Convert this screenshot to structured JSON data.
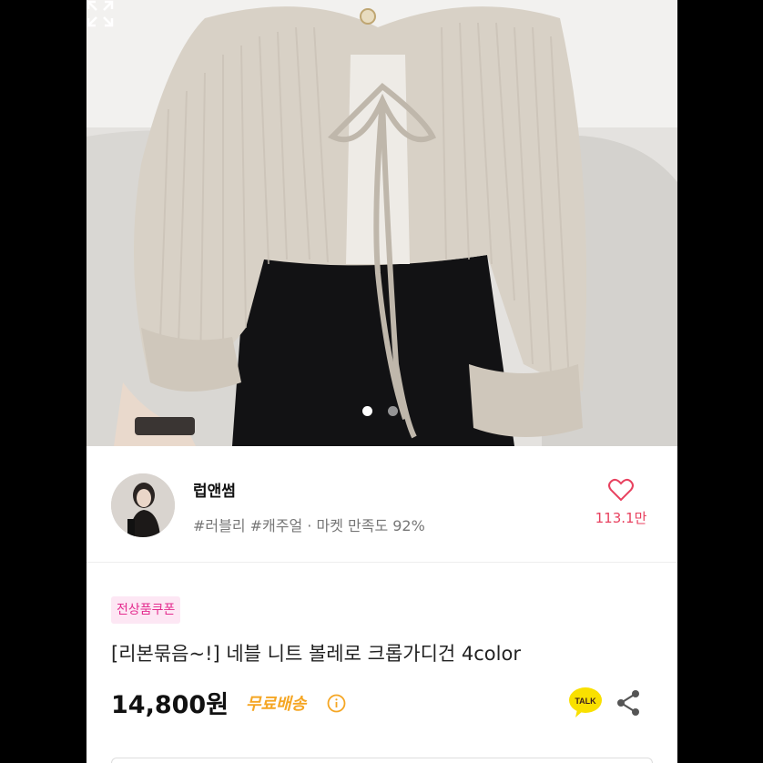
{
  "carousel": {
    "total_dots": 2,
    "active_index": 0
  },
  "seller": {
    "name": "럽앤썸",
    "tags": "#러블리 #캐주얼 · 마켓 만족도 92%",
    "like_count": "113.1만"
  },
  "product": {
    "coupon_label": "전상품쿠폰",
    "title": "[리본묶음~!] 네블 니트 볼레로 크롭가디건 4color",
    "price": "14,800원",
    "shipping_label": "무료배송"
  },
  "icons": {
    "like": "heart-icon",
    "expand": "expand-icon",
    "info": "info-icon",
    "talk": "kakaotalk-icon",
    "share": "share-icon"
  },
  "colors": {
    "accent_pink": "#e8415f",
    "coupon_bg": "#fde7f4",
    "coupon_text": "#e42d8f",
    "shipping": "#f5a623",
    "talk_yellow": "#f9e000"
  },
  "talk_badge": "TALK"
}
